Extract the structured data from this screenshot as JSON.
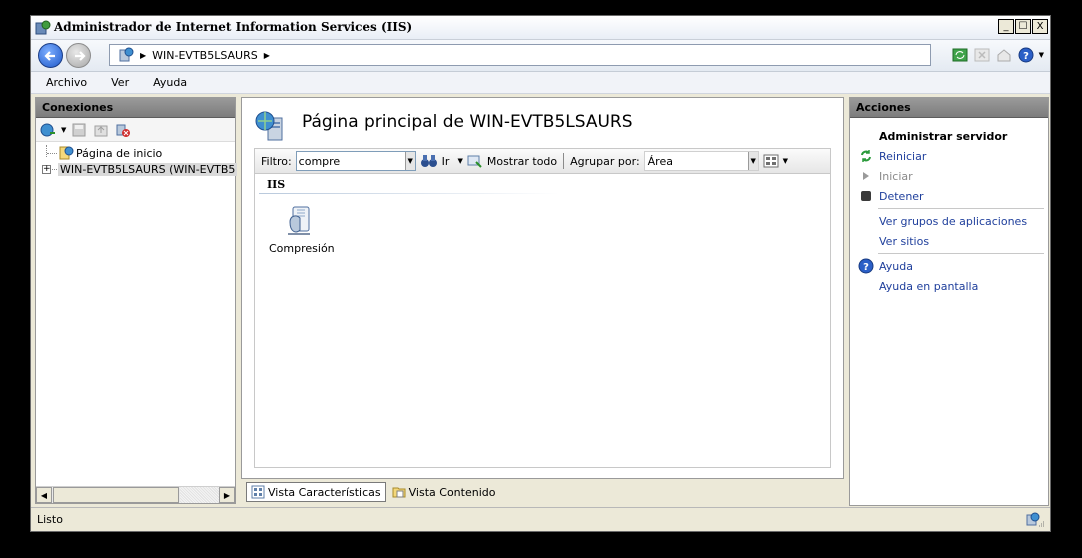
{
  "window": {
    "title": "Administrador de Internet Information Services (IIS)",
    "controls": [
      "_",
      "☐",
      "X"
    ]
  },
  "address": {
    "crumbs": [
      "WIN-EVTB5LSAURS"
    ]
  },
  "menu": {
    "items": [
      "Archivo",
      "Ver",
      "Ayuda"
    ]
  },
  "connections": {
    "header": "Conexiones",
    "tree": [
      {
        "label": "Página de inicio"
      },
      {
        "label": "WIN-EVTB5LSAURS (WIN-EVTB5"
      }
    ]
  },
  "center": {
    "title": "Página principal de WIN-EVTB5LSAURS",
    "filter_label": "Filtro:",
    "filter_value": "compre",
    "go_label": "Ir",
    "show_all_label": "Mostrar todo",
    "group_by_label": "Agrupar por:",
    "group_by_value": "Área",
    "group_header": "IIS",
    "features": [
      {
        "label": "Compresión",
        "icon": "compression-icon"
      }
    ],
    "tabs": [
      "Vista Características",
      "Vista Contenido"
    ]
  },
  "actions": {
    "header": "Acciones",
    "items": [
      {
        "label": "Administrar servidor",
        "type": "heading"
      },
      {
        "label": "Reiniciar",
        "icon": "restart-icon"
      },
      {
        "label": "Iniciar",
        "icon": "start-icon",
        "disabled": true
      },
      {
        "label": "Detener",
        "icon": "stop-icon"
      },
      {
        "label": "Ver grupos de aplicaciones"
      },
      {
        "label": "Ver sitios"
      },
      {
        "label": "Ayuda",
        "icon": "help-icon"
      },
      {
        "label": "Ayuda en pantalla"
      }
    ]
  },
  "status": {
    "text": "Listo"
  },
  "colors": {
    "link": "#1f3f9c",
    "panel_header": "#8a8a8a",
    "window_bg": "#ece9d8"
  }
}
